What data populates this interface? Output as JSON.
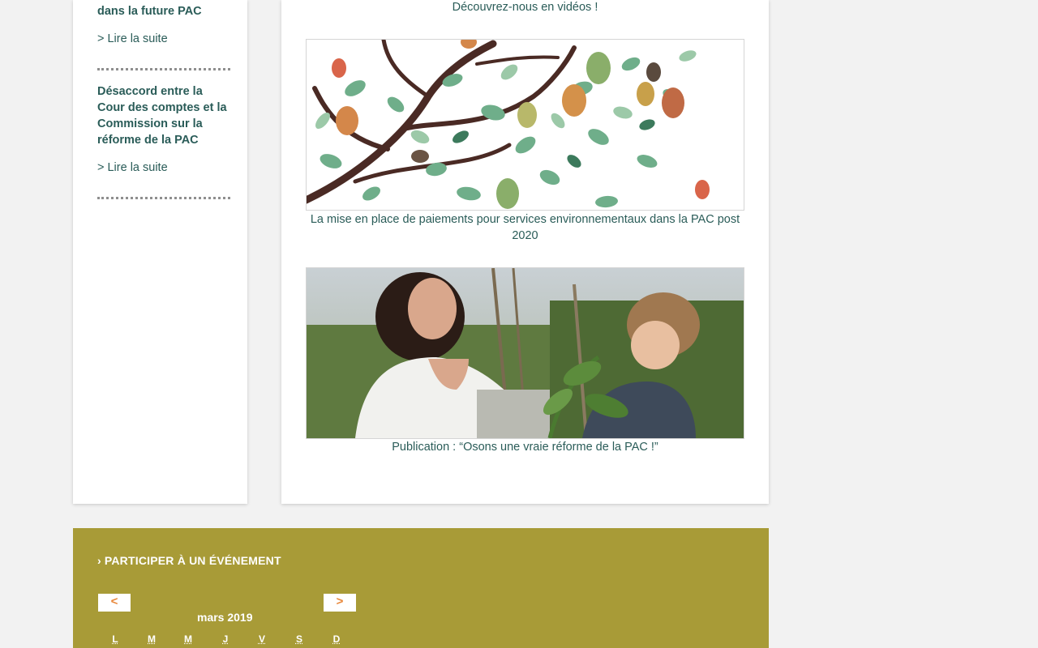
{
  "sidebar": {
    "items": [
      {
        "title": "dans la future PAC",
        "link": "> Lire la suite"
      },
      {
        "title": "Désaccord entre la Cour des comptes et la Commission sur la réforme de la PAC",
        "link": "> Lire la suite"
      }
    ]
  },
  "main": {
    "intro": "Découvrez-nous en vidéos !",
    "media": [
      {
        "caption": "La mise en place de paiements pour services environnementaux dans la PAC post 2020"
      },
      {
        "caption": "Publication : “Osons une vraie réforme de la PAC !”"
      }
    ]
  },
  "events": {
    "title": "Participer à un événement",
    "prev_label": "<",
    "next_label": ">",
    "month": "mars 2019",
    "days": [
      "L",
      "M",
      "M",
      "J",
      "V",
      "S",
      "D"
    ]
  },
  "colors": {
    "accent_text": "#2a5c58",
    "events_bg": "#a89b37",
    "nav_arrow": "#e8873a"
  }
}
